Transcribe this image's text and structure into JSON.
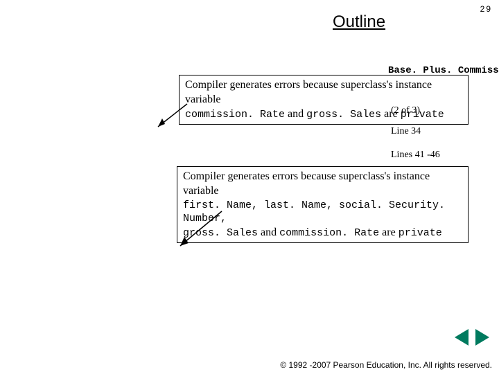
{
  "page_number": "29",
  "title": "Outline",
  "file_label": "Base. Plus. Commission",
  "callout1": {
    "line1_serif": "Compiler generates errors because superclass's instance variable",
    "line2_code_a": "commission. Rate",
    "line2_mid": " and ",
    "line2_code_b": "gross. Sales",
    "line2_mid2": " are ",
    "line2_code_c": "private"
  },
  "refs": {
    "pages": "(2 of 3)",
    "line_a": "Line 34",
    "line_b": "Lines 41 -46"
  },
  "callout2": {
    "line1_serif": "Compiler generates errors because superclass's instance variable",
    "line2_code": "first. Name, last. Name, social. Security. Number,",
    "line3_code_a": "gross. Sales",
    "line3_mid": " and ",
    "line3_code_b": "commission. Rate",
    "line3_mid2": " are ",
    "line3_code_c": "private"
  },
  "copyright": "© 1992 -2007 Pearson Education, Inc. All rights reserved."
}
